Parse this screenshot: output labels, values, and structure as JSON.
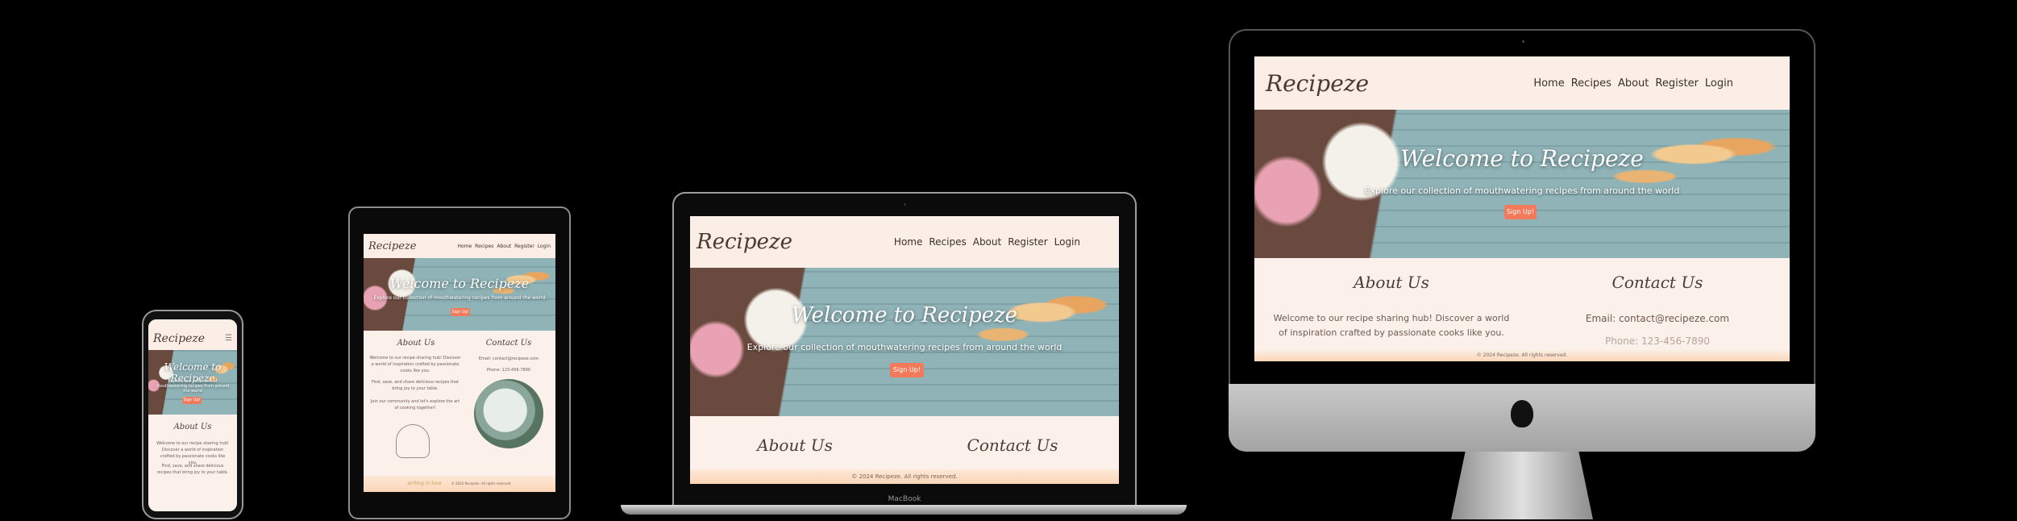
{
  "site": {
    "brand": "Recipeze",
    "nav": [
      "Home",
      "Recipes",
      "About",
      "Register",
      "Login"
    ],
    "hero_title": "Welcome to Recipeze",
    "hero_subtitle": "Explore our collection of mouthwatering recipes from around the world",
    "cta": "Sign Up!",
    "about_title": "About Us",
    "about_text_1": "Welcome to our recipe sharing hub! Discover a world of inspiration crafted by passionate cooks like you.",
    "about_text_2": "Find, save, and share delicious recipes that bring joy to your table.",
    "about_text_3": "Join our community and let's explore the art of cooking together!",
    "contact_title": "Contact Us",
    "contact_email": "Email: contact@recipeze.com",
    "contact_phone": "Phone: 123-456-7890",
    "footer": "© 2024 Recipeze. All rights reserved."
  },
  "laptop": {
    "label": "MacBook"
  },
  "tablet": {
    "banner": "writing in love"
  },
  "colors": {
    "accent": "#f27a5a",
    "background": "#000000",
    "page_bg": "#fbf1ea"
  }
}
